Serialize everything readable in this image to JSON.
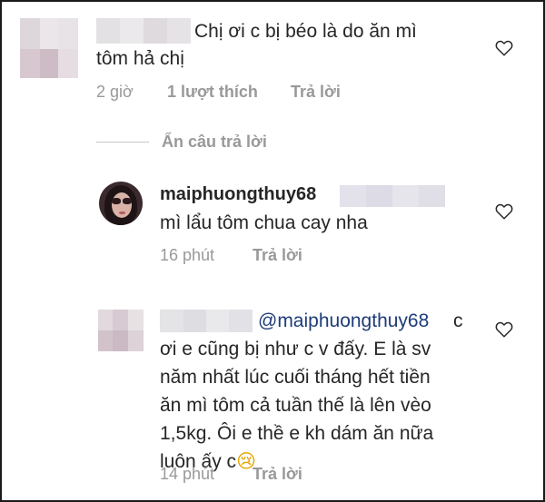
{
  "comment1": {
    "text_line1": "Chị ơi c bị béo là do ăn mì",
    "text_line2": "tôm hả chị",
    "time": "2 giờ",
    "likes": "1 lượt thích",
    "reply": "Trả lời"
  },
  "hide_replies": "Ẩn câu trả lời",
  "reply1": {
    "username": "maiphuongthuy68",
    "text": "mì lẩu tôm chua cay nha",
    "time": "16 phút",
    "reply": "Trả lời"
  },
  "reply2": {
    "mention": "@maiphuongthuy68",
    "lines": [
      "c",
      "ơi e cũng bị như c v đấy. E là sv",
      "năm nhất lúc cuối tháng hết tiền",
      "ăn mì tôm cả tuần thế là lên vèo",
      "1,5kg. Ôi e thề e kh dám ăn nữa",
      "luôn ấy c"
    ],
    "emoji": "😢",
    "time": "14 phút",
    "reply": "Trả lời"
  },
  "colors": {
    "text": "#262626",
    "meta": "#999999",
    "mention": "#1d3c78",
    "blur_light": "#e6e2e6",
    "blur_dark": "#cdbfc7"
  },
  "icons": [
    "heart-icon",
    "avatar",
    "crying-emoji"
  ]
}
